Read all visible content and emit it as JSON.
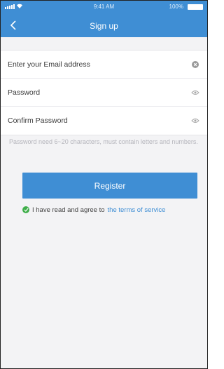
{
  "status_bar": {
    "time": "9:41 AM",
    "battery": "100%"
  },
  "nav": {
    "title": "Sign up"
  },
  "form": {
    "email_placeholder": "Enter your Email address",
    "password_placeholder": "Password",
    "confirm_placeholder": "Confirm Password"
  },
  "hint": "Password need 6~20 characters, must contain letters and numbers.",
  "register_label": "Register",
  "agreement": {
    "text": "I have read and agree to",
    "link": "the terms of service",
    "checked": true
  },
  "colors": {
    "accent": "#3f8ed4",
    "check": "#3fae4a",
    "background": "#f3f3f5"
  },
  "icons": {
    "back": "chevron-left-icon",
    "clear": "clear-circle-icon",
    "eye": "eye-icon",
    "check": "check-circle-icon"
  }
}
